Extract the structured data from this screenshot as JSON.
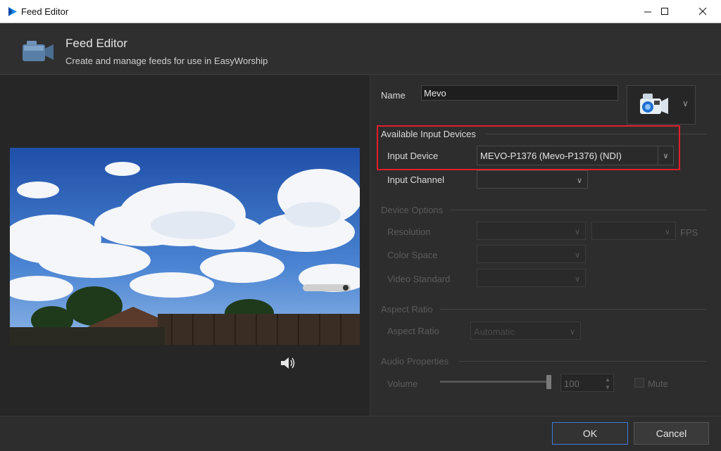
{
  "window": {
    "title": "Feed Editor"
  },
  "header": {
    "title": "Feed Editor",
    "subtitle": "Create and manage feeds for use in EasyWorship"
  },
  "form": {
    "name_label": "Name",
    "name_value": "Mevo",
    "available_section": "Available Input Devices",
    "input_device_label": "Input Device",
    "input_device_value": "MEVO-P1376 (Mevo-P1376) (NDI)",
    "input_channel_label": "Input Channel",
    "input_channel_value": "",
    "device_options_section": "Device Options",
    "resolution_label": "Resolution",
    "fps_label": "FPS",
    "color_space_label": "Color Space",
    "video_standard_label": "Video Standard",
    "aspect_section": "Aspect Ratio",
    "aspect_label": "Aspect Ratio",
    "aspect_value": "Automatic",
    "audio_section": "Audio Properties",
    "volume_label": "Volume",
    "volume_value": "100",
    "mute_label": "Mute"
  },
  "preview": {
    "volume_level": 0.9
  },
  "footer": {
    "ok_label": "OK",
    "cancel_label": "Cancel"
  },
  "colors": {
    "highlight": "#e0202a",
    "accent": "#3d7bd9"
  }
}
